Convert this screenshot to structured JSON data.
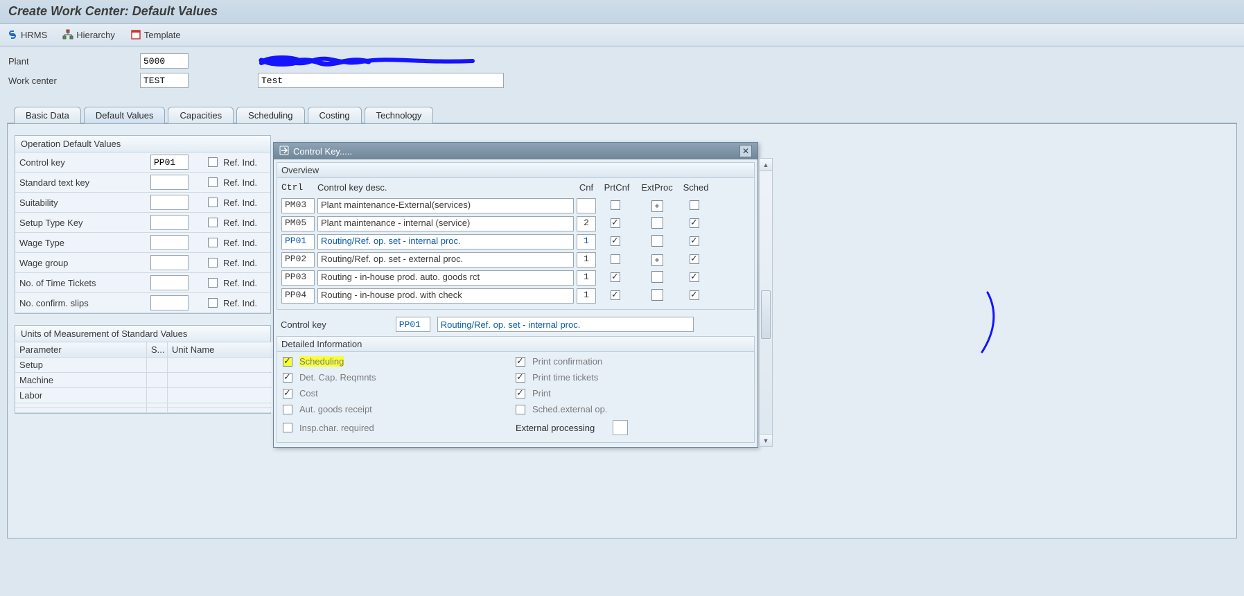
{
  "title": "Create Work Center: Default Values",
  "toolbar": {
    "hrms": "HRMS",
    "hierarchy": "Hierarchy",
    "template": "Template"
  },
  "header": {
    "plant_label": "Plant",
    "plant_value": "5000",
    "wc_label": "Work center",
    "wc_value": "TEST",
    "wc_desc": "Test"
  },
  "tabs": {
    "basic": "Basic Data",
    "defaults": "Default Values",
    "capacities": "Capacities",
    "scheduling": "Scheduling",
    "costing": "Costing",
    "technology": "Technology"
  },
  "group_op": {
    "title": "Operation Default Values",
    "rows": {
      "control_key": "Control key",
      "control_key_val": "PP01",
      "std_text": "Standard text key",
      "suitability": "Suitability",
      "setup_type": "Setup Type Key",
      "wage_type": "Wage Type",
      "wage_group": "Wage group",
      "time_tickets": "No. of Time Tickets",
      "confirm_slips": "No. confirm. slips",
      "ref": "Ref. Ind."
    }
  },
  "group_units": {
    "title": "Units of Measurement of Standard Values",
    "cols": {
      "param": "Parameter",
      "s": "S...",
      "unit": "Unit Name"
    },
    "rows": {
      "setup": "Setup",
      "machine": "Machine",
      "labor": "Labor"
    }
  },
  "popup": {
    "title": "Control Key.....",
    "overview": "Overview",
    "cols": {
      "ctrl": "Ctrl",
      "desc": "Control key desc.",
      "cnf": "Cnf",
      "prt": "PrtCnf",
      "ext": "ExtProc",
      "sched": "Sched"
    },
    "rows": [
      {
        "code": "PM03",
        "desc": "Plant maintenance-External(services)",
        "cnf": "",
        "prt": false,
        "ext": "+",
        "sched": false
      },
      {
        "code": "PM05",
        "desc": "Plant maintenance - internal (service)",
        "cnf": "2",
        "prt": true,
        "ext": "",
        "sched": true
      },
      {
        "code": "PP01",
        "desc": "Routing/Ref. op. set - internal proc.",
        "cnf": "1",
        "prt": true,
        "ext": "",
        "sched": true,
        "selected": true
      },
      {
        "code": "PP02",
        "desc": "Routing/Ref. op. set - external proc.",
        "cnf": "1",
        "prt": false,
        "ext": "+",
        "sched": true
      },
      {
        "code": "PP03",
        "desc": "Routing - in-house prod. auto. goods rct",
        "cnf": "1",
        "prt": true,
        "ext": "",
        "sched": true
      },
      {
        "code": "PP04",
        "desc": "Routing - in-house prod. with check",
        "cnf": "1",
        "prt": true,
        "ext": "",
        "sched": true
      }
    ],
    "ctl_label": "Control key",
    "ctl_value": "PP01",
    "ctl_desc": "Routing/Ref. op. set - internal proc.",
    "info_title": "Detailed Information",
    "info": {
      "scheduling": "Scheduling",
      "det_cap": "Det. Cap. Reqmnts",
      "cost": "Cost",
      "auto_gr": "Aut. goods receipt",
      "insp": "Insp.char. required",
      "print_conf": "Print confirmation",
      "print_tt": "Print time tickets",
      "print": "Print",
      "sched_ext": "Sched.external op.",
      "ext_proc": "External processing"
    }
  }
}
